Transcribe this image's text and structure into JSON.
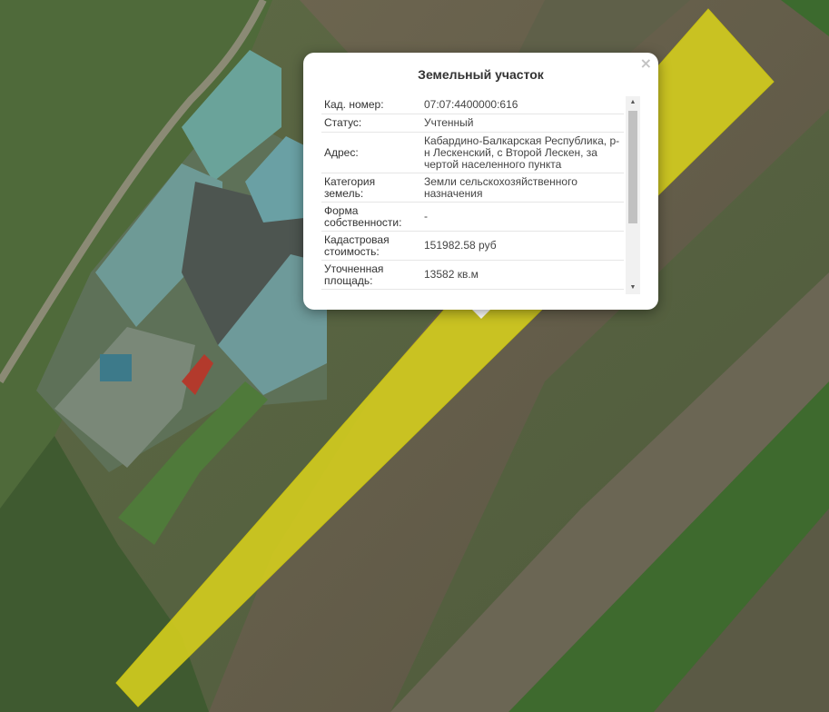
{
  "popup": {
    "title": "Земельный участок",
    "close_symbol": "×",
    "rows": [
      {
        "key": "Кад. номер:",
        "value": "07:07:4400000:616"
      },
      {
        "key": "Статус:",
        "value": "Учтенный"
      },
      {
        "key": "Адрес:",
        "value": "Кабардино-Балкарская Республика, р-н Лескенский, с Второй Лескен, за чертой населенного пункта"
      },
      {
        "key": "Категория земель:",
        "value": "Земли сельскохозяйственного назначения"
      },
      {
        "key": "Форма собственности:",
        "value": "-"
      },
      {
        "key": "Кадастровая стоимость:",
        "value": "151982.58 руб"
      },
      {
        "key": "Уточненная площадь:",
        "value": "13582 кв.м"
      }
    ],
    "scroll_up_symbol": "▲",
    "scroll_down_symbol": "▼"
  },
  "map": {
    "parcel_fill_color": "#d4cd1e"
  }
}
